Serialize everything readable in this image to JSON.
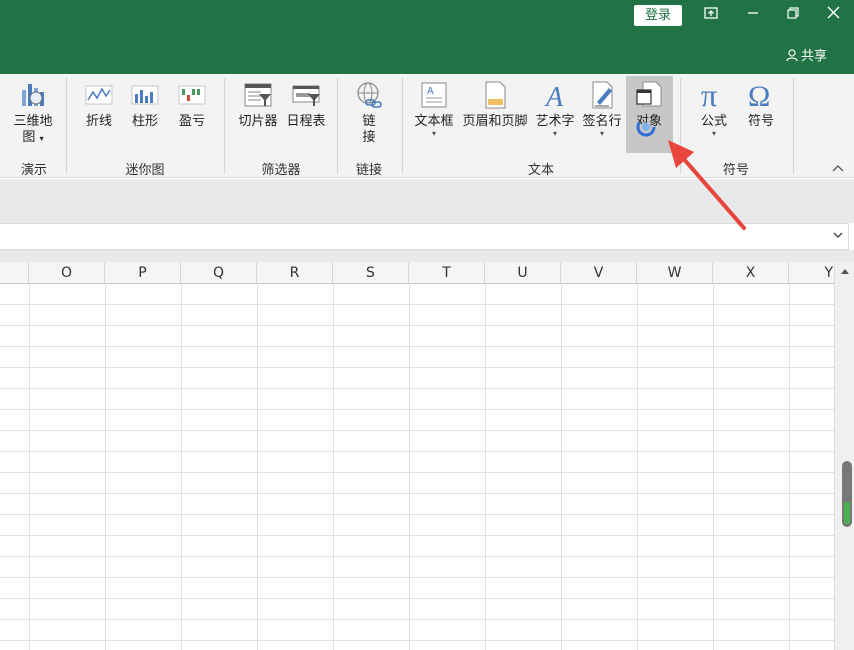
{
  "titlebar": {
    "login_label": "登录",
    "share_label": "共享",
    "color": "#217346"
  },
  "ribbon": {
    "tools": {
      "map3d": "三维地",
      "map3d_line2": "图",
      "line": "折线",
      "column": "柱形",
      "winloss": "盈亏",
      "slicer": "切片器",
      "timeline": "日程表",
      "link_line1": "链",
      "link_line2": "接",
      "textbox": "文本框",
      "header_footer": "页眉和页脚",
      "wordart": "艺术字",
      "signature": "签名行",
      "object": "对象",
      "formula": "公式",
      "symbol": "符号"
    },
    "groups": {
      "demo": "演示",
      "sparkline": "迷你图",
      "filter": "筛选器",
      "links": "链接",
      "text": "文本",
      "symbols": "符号"
    }
  },
  "sheet": {
    "columns": [
      "O",
      "P",
      "Q",
      "R",
      "S",
      "T",
      "U",
      "V",
      "W",
      "X",
      "Y"
    ]
  },
  "colors": {
    "arrow": "#e8453c",
    "accent": "#217346"
  }
}
